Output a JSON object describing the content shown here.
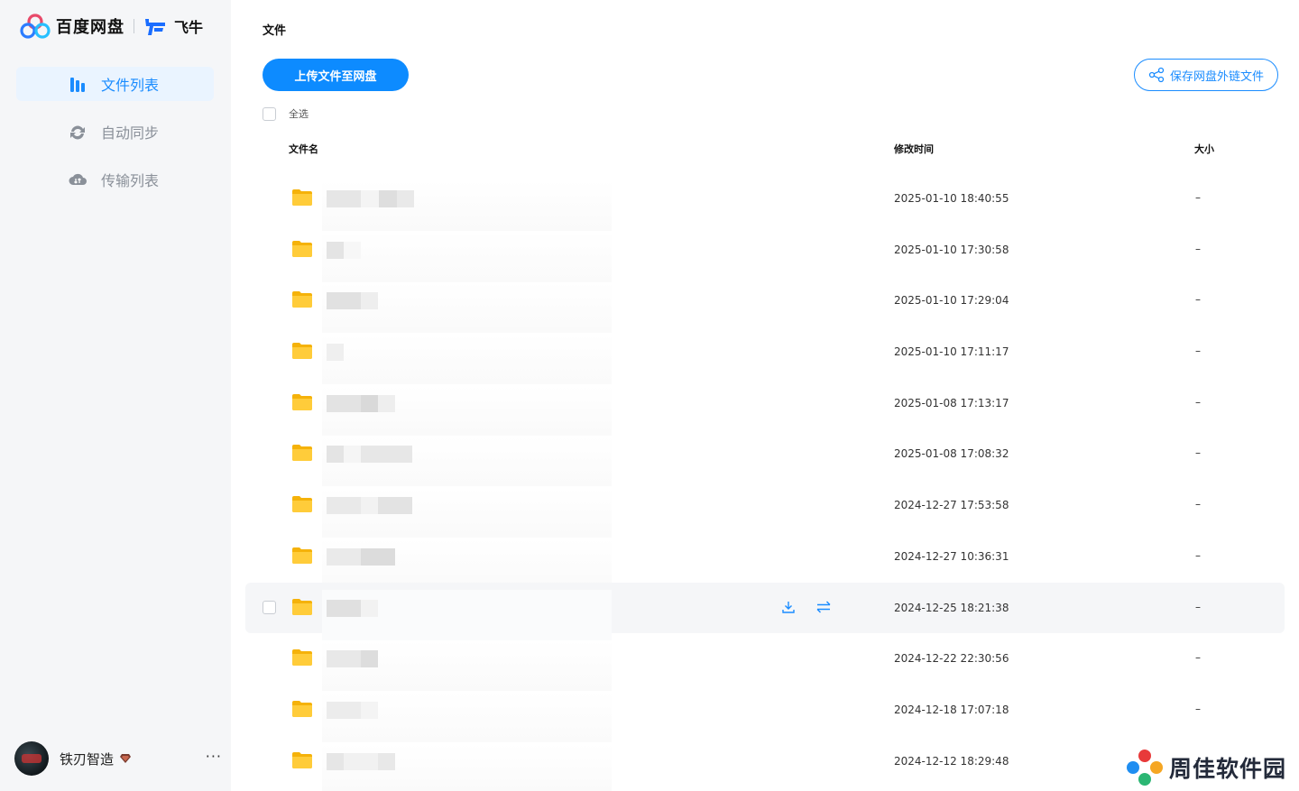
{
  "brand": {
    "baidu_name": "百度网盘",
    "feiniu_name": "飞牛"
  },
  "sidebar": {
    "items": [
      {
        "label": "文件列表",
        "icon": "file-list-icon",
        "active": true
      },
      {
        "label": "自动同步",
        "icon": "sync-icon",
        "active": false
      },
      {
        "label": "传输列表",
        "icon": "cloud-transfer-icon",
        "active": false
      }
    ],
    "user": {
      "name": "铁刃智造",
      "more": "···"
    }
  },
  "main": {
    "title": "文件",
    "upload_button": "上传文件至网盘",
    "save_link_button": "保存网盘外链文件",
    "select_all": "全选",
    "columns": {
      "name": "文件名",
      "modified": "修改时间",
      "size": "大小"
    },
    "rows": [
      {
        "modified": "2025-01-10 18:40:55",
        "size": "–"
      },
      {
        "modified": "2025-01-10 17:30:58",
        "size": "–"
      },
      {
        "modified": "2025-01-10 17:29:04",
        "size": "–"
      },
      {
        "modified": "2025-01-10 17:11:17",
        "size": "–"
      },
      {
        "modified": "2025-01-08 17:13:17",
        "size": "–"
      },
      {
        "modified": "2025-01-08 17:08:32",
        "size": "–"
      },
      {
        "modified": "2024-12-27 17:53:58",
        "size": "–"
      },
      {
        "modified": "2024-12-27 10:36:31",
        "size": "–"
      },
      {
        "modified": "2024-12-25 18:21:38",
        "size": "–",
        "hover": true
      },
      {
        "modified": "2024-12-22 22:30:56",
        "size": "–"
      },
      {
        "modified": "2024-12-18 17:07:18",
        "size": "–"
      },
      {
        "modified": "2024-12-12 18:29:48",
        "size": "–"
      }
    ]
  },
  "watermark": {
    "text": "周佳软件园"
  },
  "colors": {
    "accent": "#1a8cff",
    "upload_bg": "#0d8bff",
    "sidebar_bg": "#f5f6f8",
    "folder": "#ffc933",
    "hover_row": "#f5f6f8"
  }
}
